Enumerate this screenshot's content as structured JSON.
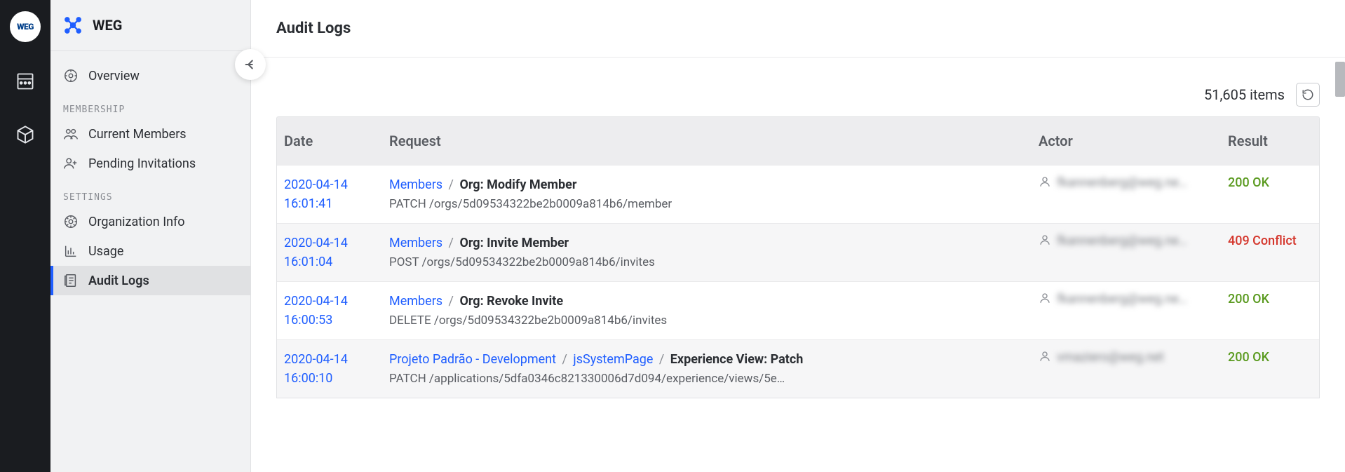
{
  "rail": {
    "logo_text": "WEG"
  },
  "sidebar": {
    "title": "WEG",
    "overview_label": "Overview",
    "section_membership": "MEMBERSHIP",
    "current_members_label": "Current Members",
    "pending_invitations_label": "Pending Invitations",
    "section_settings": "SETTINGS",
    "org_info_label": "Organization Info",
    "usage_label": "Usage",
    "audit_logs_label": "Audit Logs"
  },
  "main": {
    "title": "Audit Logs",
    "item_count": "51,605 items"
  },
  "table": {
    "headers": {
      "date": "Date",
      "request": "Request",
      "actor": "Actor",
      "result": "Result"
    },
    "rows": [
      {
        "date": "2020-04-14",
        "time": "16:01:41",
        "crumbs": [
          "Members"
        ],
        "action": "Org: Modify Member",
        "method_path": "PATCH /orgs/5d09534322be2b0009a814b6/member",
        "actor": "fkannenberg@weg.ne…",
        "result": "200 OK",
        "ok": true
      },
      {
        "date": "2020-04-14",
        "time": "16:01:04",
        "crumbs": [
          "Members"
        ],
        "action": "Org: Invite Member",
        "method_path": "POST /orgs/5d09534322be2b0009a814b6/invites",
        "actor": "fkannenberg@weg.ne…",
        "result": "409 Conflict",
        "ok": false
      },
      {
        "date": "2020-04-14",
        "time": "16:00:53",
        "crumbs": [
          "Members"
        ],
        "action": "Org: Revoke Invite",
        "method_path": "DELETE /orgs/5d09534322be2b0009a814b6/invites",
        "actor": "fkannenberg@weg.ne…",
        "result": "200 OK",
        "ok": true
      },
      {
        "date": "2020-04-14",
        "time": "16:00:10",
        "crumbs": [
          "Projeto Padrão - Development",
          "jsSystemPage"
        ],
        "action": "Experience View: Patch",
        "method_path": "PATCH /applications/5dfa0346c821330006d7d094/experience/views/5e…",
        "actor": "vmaziero@weg.net",
        "result": "200 OK",
        "ok": true
      }
    ]
  }
}
